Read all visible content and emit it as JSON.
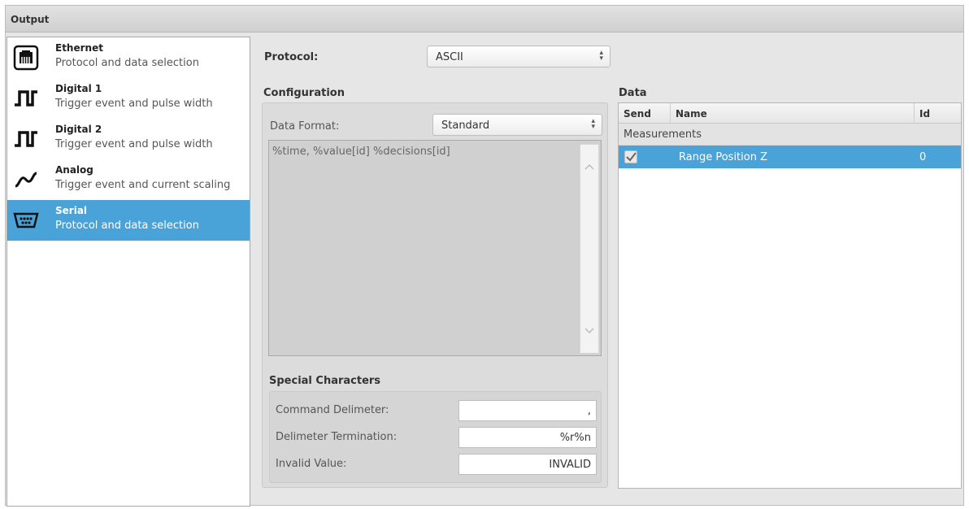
{
  "window": {
    "title": "Output"
  },
  "nav": {
    "items": [
      {
        "title": "Ethernet",
        "subtitle": "Protocol and data selection",
        "icon": "ethernet-icon",
        "selected": false
      },
      {
        "title": "Digital 1",
        "subtitle": "Trigger event and pulse width",
        "icon": "pulse-icon",
        "selected": false
      },
      {
        "title": "Digital 2",
        "subtitle": "Trigger event and pulse width",
        "icon": "pulse-icon",
        "selected": false
      },
      {
        "title": "Analog",
        "subtitle": "Trigger event and current scaling",
        "icon": "sine-wave-icon",
        "selected": false
      },
      {
        "title": "Serial",
        "subtitle": "Protocol and data selection",
        "icon": "serial-port-icon",
        "selected": true
      }
    ]
  },
  "protocol": {
    "label": "Protocol:",
    "value": "ASCII"
  },
  "configuration": {
    "heading": "Configuration",
    "data_format_label": "Data Format:",
    "data_format_value": "Standard",
    "format_text": "%time, %value[id] %decisions[id]"
  },
  "special_characters": {
    "heading": "Special Characters",
    "command_delimiter_label": "Command Delimeter:",
    "command_delimiter_value": ",",
    "delimiter_termination_label": "Delimeter Termination:",
    "delimiter_termination_value": "%r%n",
    "invalid_value_label": "Invalid Value:",
    "invalid_value_value": "INVALID"
  },
  "data": {
    "heading": "Data",
    "columns": {
      "send": "Send",
      "name": "Name",
      "id": "Id"
    },
    "group": "Measurements",
    "rows": [
      {
        "checked": true,
        "name": "Range Position Z",
        "id": "0"
      }
    ]
  },
  "colors": {
    "accent": "#4aa3d8",
    "panel": "#e6e6e6"
  }
}
